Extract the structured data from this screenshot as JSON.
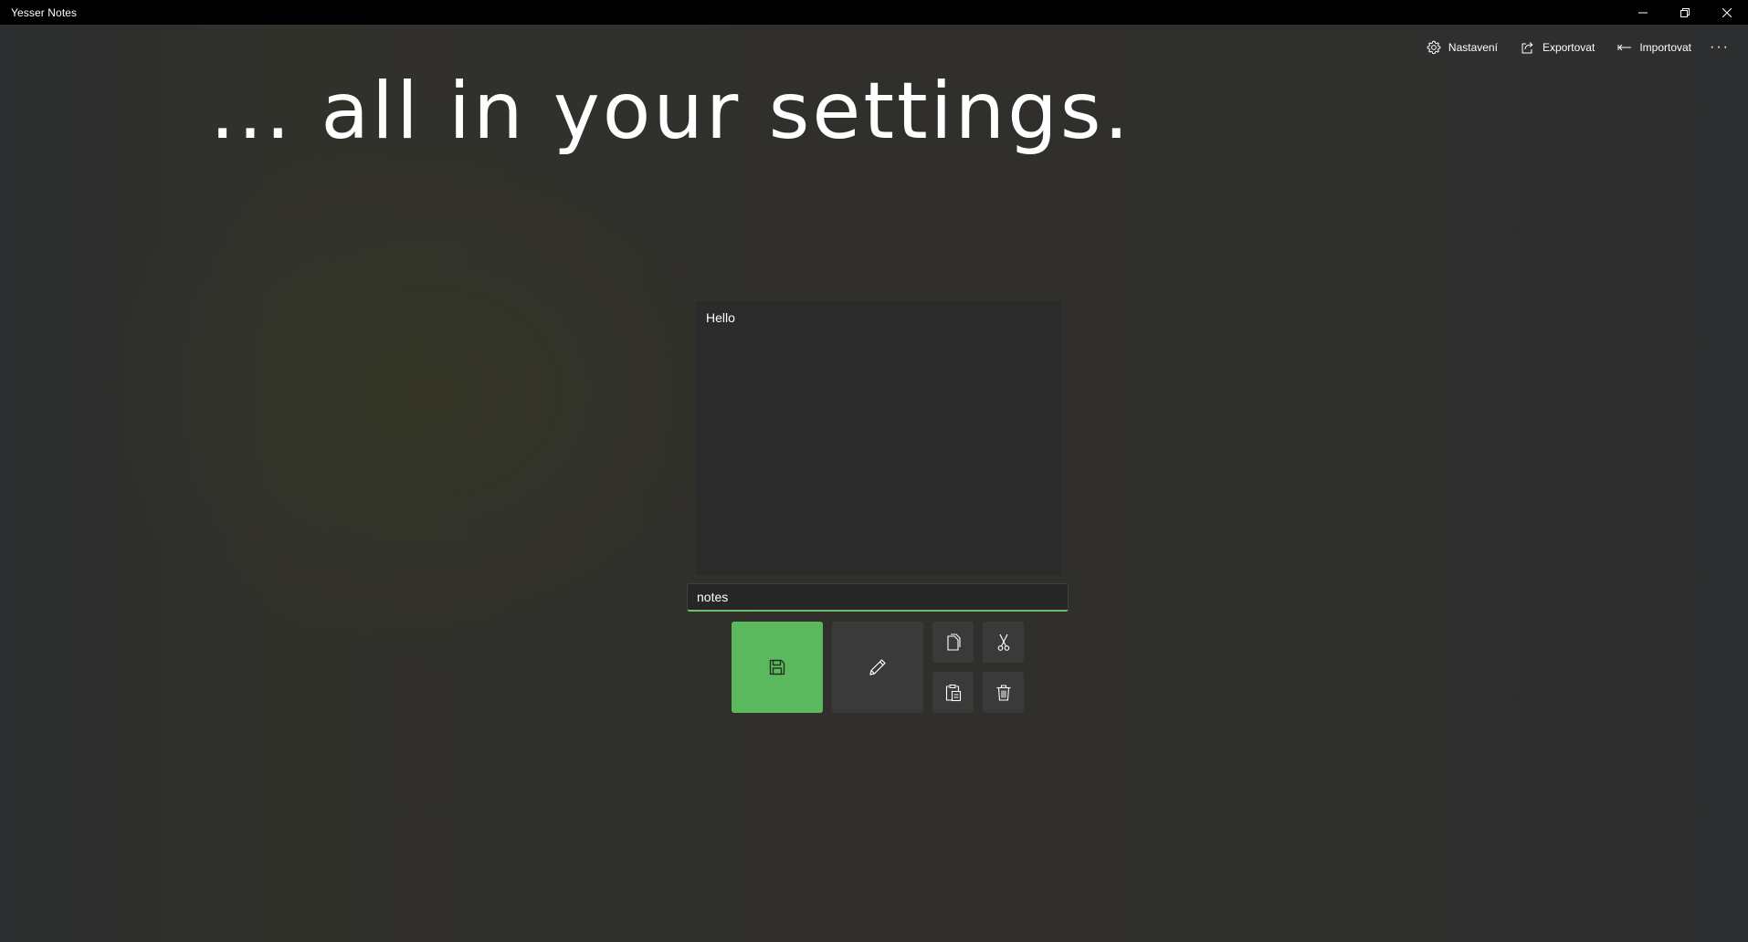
{
  "window": {
    "title": "Yesser Notes",
    "controls": {
      "minimize_icon": "minimize-icon",
      "restore_icon": "restore-icon",
      "close_icon": "close-icon"
    }
  },
  "commandbar": {
    "settings_label": "Nastavení",
    "export_label": "Exportovat",
    "import_label": "Importovat",
    "more_label": "···"
  },
  "main": {
    "headline": "... all in your settings.",
    "note_text": "Hello",
    "filename_value": "notes"
  },
  "actions": {
    "save_icon": "save-icon",
    "edit_icon": "pencil-icon",
    "copy_icon": "copy-icon",
    "cut_icon": "scissors-icon",
    "paste_icon": "paste-icon",
    "delete_icon": "trash-icon"
  },
  "colors": {
    "accent": "#5cb85c",
    "titlebar": "#000000",
    "button": "#3a3a3a"
  }
}
